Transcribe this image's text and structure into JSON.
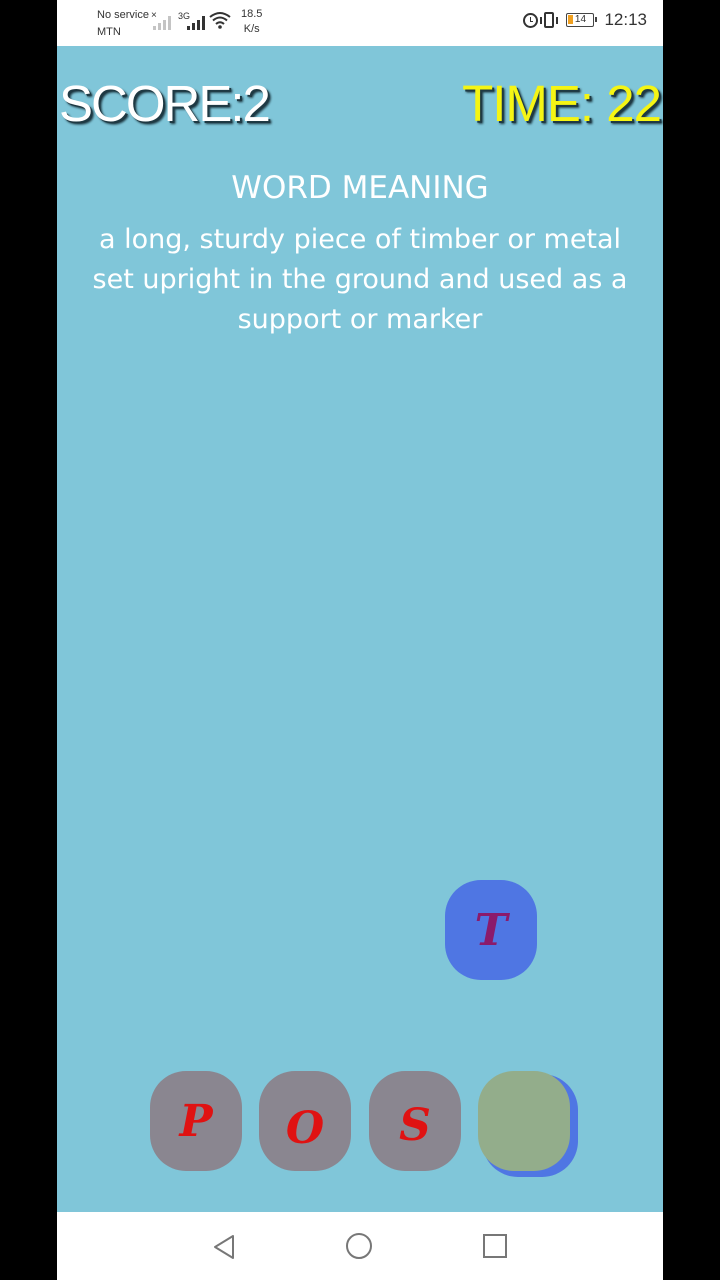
{
  "status_bar": {
    "carrier_line1": "No service",
    "carrier_x": "×",
    "carrier_line2": "MTN",
    "network_type": "3G",
    "speed_value": "18.5",
    "speed_unit": "K/s",
    "battery_level": "14",
    "time": "12:13",
    "icons": [
      "signal-dim-icon",
      "signal-icon",
      "wifi-icon",
      "alarm-icon",
      "vibrate-icon",
      "battery-icon"
    ]
  },
  "game": {
    "score_label": "SCORE:2",
    "time_label": "TIME: 22",
    "meaning_title": "WORD MEANING",
    "meaning_text": "a long, sturdy piece of timber or metal set upright in the ground and used as a support or marker",
    "floating_tile": "T",
    "slots": [
      "P",
      "O",
      "S",
      ""
    ],
    "colors": {
      "background": "#80c6d9",
      "score": "#ffffff",
      "time": "#f5f514",
      "tile_blue": "#4f76e3",
      "tile_gray": "#8a8690",
      "slot_empty": "#93ad8b",
      "letter_red": "#e01212",
      "letter_purple": "#8b1a6b"
    }
  },
  "nav_bar": {
    "icons": [
      "back-icon",
      "home-icon",
      "recent-apps-icon"
    ]
  }
}
